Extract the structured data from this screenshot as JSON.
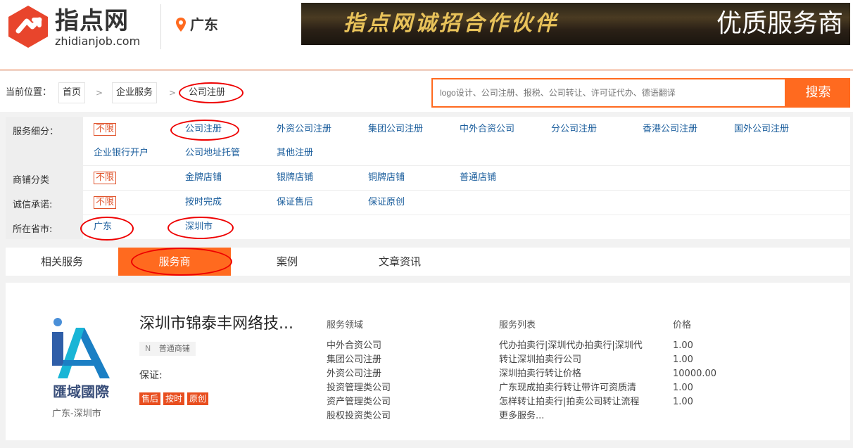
{
  "header": {
    "logo_text": "指点网",
    "logo_sub": "zhidianjob.com",
    "location": "广东",
    "banner_script": "指点网诚招合作伙伴",
    "banner_right": "优质服务商"
  },
  "breadcrumb": {
    "label": "当前位置：",
    "items": [
      "首页",
      "企业服务",
      "公司注册"
    ],
    "separator": ">"
  },
  "search": {
    "placeholder": "logo设计、公司注册、报税、公司转让、许可证代办、德语翻译",
    "button": "搜索"
  },
  "filters": {
    "no_limit": "不限",
    "service": {
      "label": "服务细分：",
      "items": [
        "公司注册",
        "外资公司注册",
        "集团公司注册",
        "中外合资公司",
        "分公司注册",
        "香港公司注册",
        "国外公司注册",
        "企业银行开户",
        "公司地址托管",
        "其他注册"
      ]
    },
    "shop": {
      "label": "商铺分类",
      "items": [
        "金牌店铺",
        "银牌店铺",
        "铜牌店铺",
        "普通店铺"
      ]
    },
    "credit": {
      "label": "诚信承诺:",
      "items": [
        "按时完成",
        "保证售后",
        "保证原创"
      ]
    },
    "province": {
      "label": "所在省市:",
      "items": [
        "广东",
        "深圳市"
      ]
    }
  },
  "tabs": [
    "相关服务",
    "服务商",
    "案例",
    "文章资讯"
  ],
  "listing": {
    "logo_text": "匯域國際",
    "location": "广东-深圳市",
    "name": "深圳市锦泰丰网络技...",
    "badge_letter": "N",
    "badge": "普通商铺",
    "guarantee_label": "保证:",
    "guarantee_tags": [
      "售后",
      "按时",
      "原创"
    ],
    "headers": {
      "fields": "服务领域",
      "services": "服务列表",
      "price": "价格"
    },
    "fields": [
      "中外合资公司",
      "集团公司注册",
      "外资公司注册",
      "投资管理类公司",
      "资产管理类公司",
      "股权投资类公司"
    ],
    "services": [
      "代办拍卖行|深圳代办拍卖行|深圳代",
      "转让深圳拍卖行公司",
      "深圳拍卖行转让价格",
      "广东现成拍卖行转让带许可资质清",
      "怎样转让拍卖行|拍卖公司转让流程",
      "更多服务..."
    ],
    "prices": [
      "1.00",
      "1.00",
      "10000.00",
      "1.00",
      "1.00"
    ]
  },
  "colors": {
    "accent": "#ff6a1f",
    "link": "#1a5d9c",
    "annotation": "#e00000"
  }
}
